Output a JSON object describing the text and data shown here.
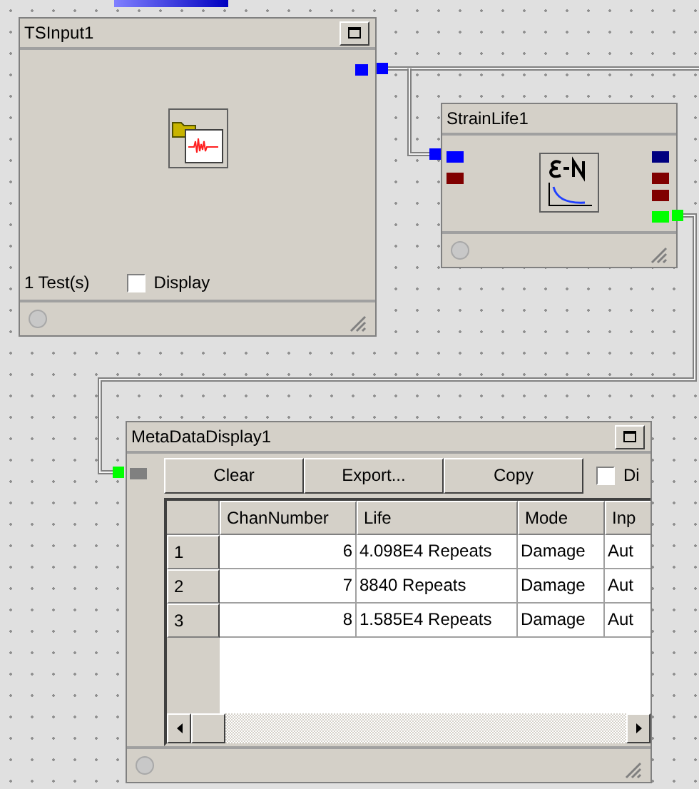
{
  "nodes": [
    {
      "kind": "input",
      "title": "TSInput1",
      "status": "1 Test(s)",
      "display": {
        "label": "Display",
        "checked": false
      },
      "ports_right": [
        {
          "color": "#0000ff"
        }
      ]
    },
    {
      "kind": "strain",
      "title": "StrainLife1",
      "ports_left": [
        {
          "color": "#0000ff"
        },
        {
          "color": "#800000"
        }
      ],
      "ports_right": [
        {
          "color": "#000080"
        },
        {
          "color": "#800000"
        },
        {
          "color": "#800000"
        },
        {
          "color": "#00ff00"
        }
      ]
    },
    {
      "kind": "table",
      "title": "MetaDataDisplay1",
      "ports_left": [
        {
          "color": "#808080"
        }
      ],
      "buttons": [
        "Clear",
        "Export...",
        "Copy"
      ],
      "display": {
        "label": "Di",
        "checked": false
      },
      "table": {
        "columns": [
          "ChanNumber",
          "Life",
          "Mode",
          "Inp"
        ],
        "rows": [
          {
            "index": "1",
            "cells": [
              "6",
              "4.098E4 Repeats",
              "Damage",
              "Aut"
            ]
          },
          {
            "index": "2",
            "cells": [
              "7",
              "8840 Repeats",
              "Damage",
              "Aut"
            ]
          },
          {
            "index": "3",
            "cells": [
              "8",
              "1.585E4 Repeats",
              "Damage",
              "Aut"
            ]
          }
        ]
      }
    }
  ]
}
